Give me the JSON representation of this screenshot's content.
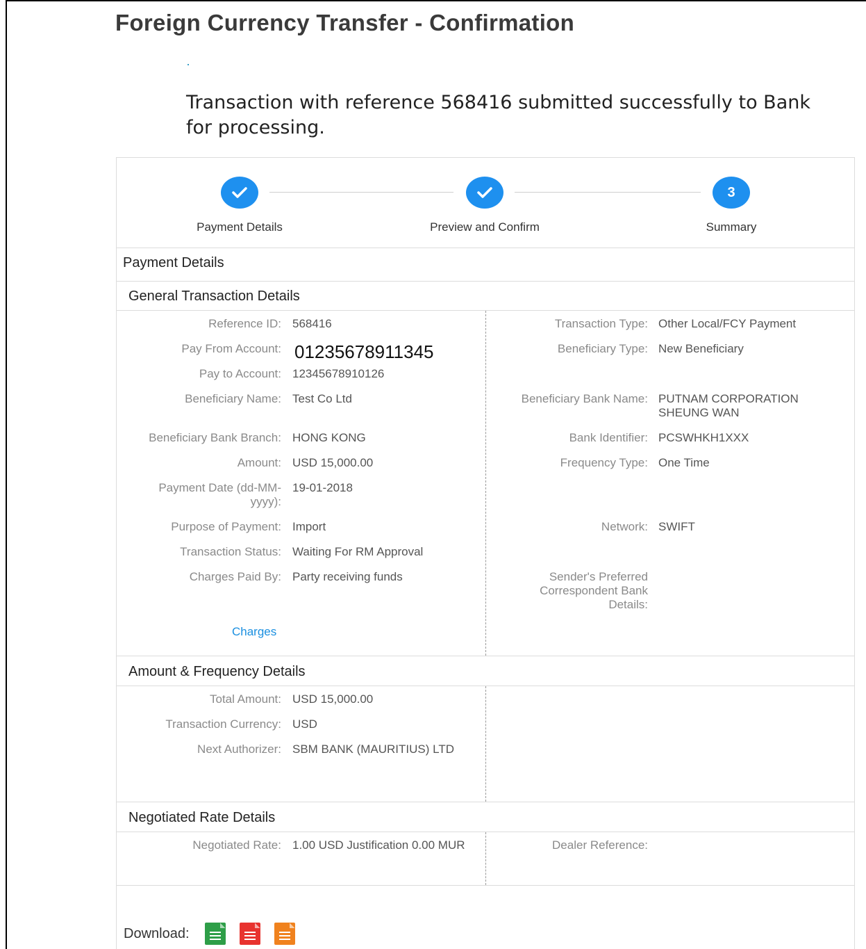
{
  "title": "Foreign Currency Transfer - Confirmation",
  "success_message": "Transaction with reference 568416 submitted successfully to Bank for processing.",
  "steps": [
    {
      "label": "Payment Details",
      "state": "done",
      "icon": "check-icon"
    },
    {
      "label": "Preview and Confirm",
      "state": "done",
      "icon": "check-icon"
    },
    {
      "label": "Summary",
      "state": "current",
      "number": "3"
    }
  ],
  "payment_details_title": "Payment Details",
  "general": {
    "title": "General Transaction Details",
    "left": [
      {
        "label": "Reference ID:",
        "value": "568416"
      },
      {
        "label": "Pay From Account:",
        "value": "01235678911345"
      },
      {
        "label": "Pay to Account:",
        "value": "12345678910126"
      },
      {
        "label": "Beneficiary Name:",
        "value": "Test Co Ltd"
      },
      {
        "label": "Beneficiary Bank Branch:",
        "value": "HONG KONG"
      },
      {
        "label": "Amount:",
        "value": "USD 15,000.00"
      },
      {
        "label": "Payment Date (dd-MM-yyyy):",
        "value": "19-01-2018"
      },
      {
        "label": "Purpose of Payment:",
        "value": "Import"
      },
      {
        "label": "Transaction Status:",
        "value": "Waiting For RM Approval"
      },
      {
        "label": "Charges Paid By:",
        "value": "Party receiving funds"
      }
    ],
    "charges_link": "Charges",
    "right": [
      {
        "label": "Transaction Type:",
        "value": "Other Local/FCY Payment"
      },
      {
        "label": "Beneficiary Type:",
        "value": "New Beneficiary"
      },
      {
        "label": "Beneficiary Bank Name:",
        "value": "PUTNAM CORPORATION SHEUNG WAN"
      },
      {
        "label": "Bank Identifier:",
        "value": "PCSWHKH1XXX"
      },
      {
        "label": "Frequency Type:",
        "value": "One Time"
      },
      {
        "label": "Network:",
        "value": "SWIFT"
      },
      {
        "label": "Sender's Preferred Correspondent Bank Details:",
        "value": ""
      }
    ]
  },
  "amount": {
    "title": "Amount & Frequency Details",
    "left": [
      {
        "label": "Total Amount:",
        "value": "USD 15,000.00"
      },
      {
        "label": "Transaction Currency:",
        "value": "USD"
      },
      {
        "label": "Next Authorizer:",
        "value": "SBM BANK (MAURITIUS) LTD"
      }
    ]
  },
  "rate": {
    "title": "Negotiated Rate Details",
    "left": [
      {
        "label": "Negotiated Rate:",
        "value": "1.00 USD Justification 0.00 MUR"
      }
    ],
    "right": [
      {
        "label": "Dealer Reference:",
        "value": ""
      }
    ]
  },
  "download": {
    "label": "Download:",
    "formats": [
      {
        "icon": "excel-file-icon",
        "color": "#2e9e48"
      },
      {
        "icon": "pdf-file-icon",
        "color": "#e8332f"
      },
      {
        "icon": "text-file-icon",
        "color": "#f0821e"
      }
    ]
  }
}
